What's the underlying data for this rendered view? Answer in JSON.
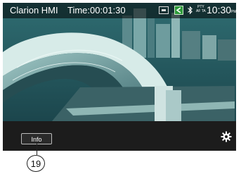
{
  "header": {
    "app_name": "Clarion HMI",
    "time_label": "Time:00:01:30",
    "clock": "10:30",
    "clock_ampm": "PM",
    "pty_line1": "PTY",
    "pty_line2": "AF TA"
  },
  "controls": {
    "info_label": "Info"
  },
  "callout": {
    "number": "19"
  },
  "icons": {
    "source": "source-screen-icon",
    "navigation": "navigation-icon",
    "bluetooth": "bluetooth-icon",
    "settings": "gear-icon"
  },
  "colors": {
    "nav_icon": "#2e9b3a",
    "bottom_bar": "#1c1c1c"
  }
}
